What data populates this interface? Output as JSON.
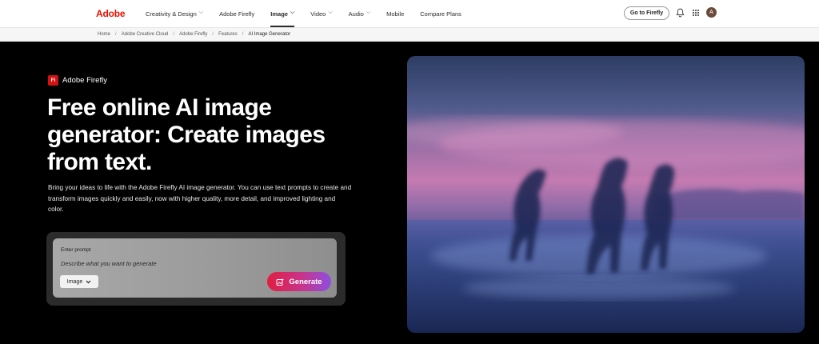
{
  "nav": {
    "brand": "Adobe",
    "links": [
      {
        "label": "Creativity & Design",
        "has_chevron": true
      },
      {
        "label": "Adobe Firefly",
        "has_chevron": false
      },
      {
        "label": "Image",
        "has_chevron": true,
        "active": true
      },
      {
        "label": "Video",
        "has_chevron": true
      },
      {
        "label": "Audio",
        "has_chevron": true
      },
      {
        "label": "Mobile",
        "has_chevron": false
      },
      {
        "label": "Compare Plans",
        "has_chevron": false
      }
    ],
    "goto_button": "Go to Firefly",
    "bell_icon": "bell-icon",
    "apps_icon": "app-grid-icon",
    "avatar_initial": "A"
  },
  "breadcrumb": {
    "items": [
      "Home",
      "Adobe Creative Cloud",
      "Adobe Firefly",
      "Features",
      "AI Image Generator"
    ],
    "separator": "/"
  },
  "hero": {
    "product_logo": "Fi",
    "product_name": "Adobe Firefly",
    "headline": "Free online AI image generator: Create images from text.",
    "description": "Bring your ideas to life with the Adobe Firefly AI image generator. You can use text prompts to create and transform images quickly and easily, now with higher quality, more detail, and improved lighting and color.",
    "prompt": {
      "label": "Enter prompt",
      "placeholder": "Describe what you want to generate",
      "value": "",
      "type_select": "Image",
      "generate_label": "Generate",
      "generate_icon": "sparkle-image-icon"
    }
  },
  "colors": {
    "brand_red": "#eb1000",
    "generate_gradient_start": "#e01e42",
    "generate_gradient_end": "#8d4fe0"
  }
}
